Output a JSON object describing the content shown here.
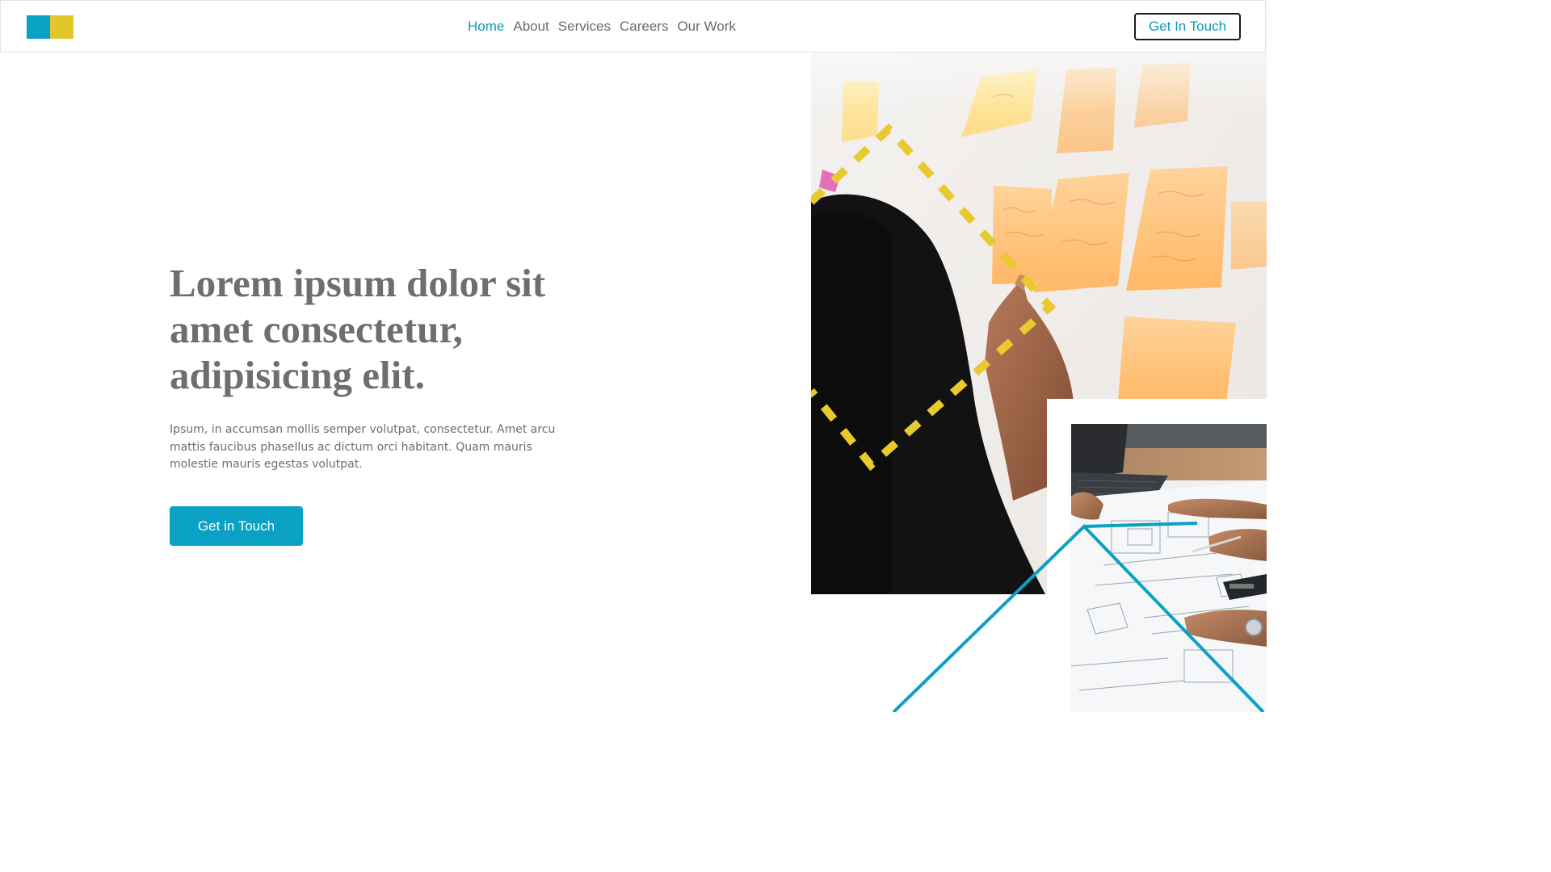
{
  "header": {
    "logo_name": "brand-logo",
    "colors": {
      "logo_primary": "#0aa1c4",
      "logo_secondary": "#e2c72c"
    },
    "nav": [
      {
        "label": "Home",
        "active": true
      },
      {
        "label": "About",
        "active": false
      },
      {
        "label": "Services",
        "active": false
      },
      {
        "label": "Careers",
        "active": false
      },
      {
        "label": "Our Work",
        "active": false
      }
    ],
    "cta_label": "Get In Touch"
  },
  "hero": {
    "title": "Lorem ipsum dolor sit amet consectetur, adipisicing elit.",
    "body": "Ipsum, in accumsan mollis semper volutpat, consectetur. Amet arcu mattis faucibus phasellus ac dictum orci habitant. Quam mauris molestie mauris egestas volutpat.",
    "cta_label": "Get in Touch",
    "accent_color": "#0aa1c4"
  }
}
